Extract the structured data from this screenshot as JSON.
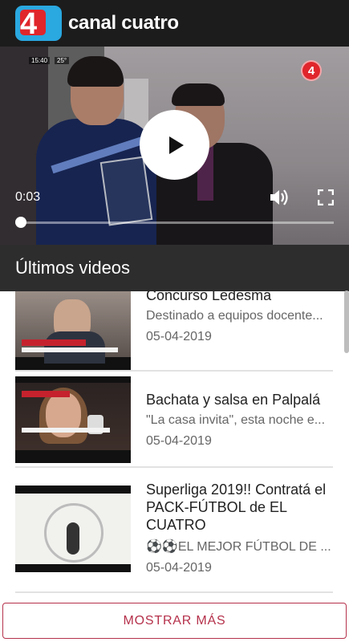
{
  "header": {
    "logo_text": "4",
    "brand": "canal cuatro"
  },
  "player": {
    "overlay_clock": "15:40",
    "overlay_temp": "25°",
    "watermark": "4",
    "current_time": "0:03",
    "progress_fraction": 0.0
  },
  "section": {
    "title": "Últimos videos"
  },
  "videos": [
    {
      "title": "Concurso Ledesma",
      "description": "Destinado a equipos docente...",
      "date": "05-04-2019"
    },
    {
      "title": "Bachata y salsa en Palpalá",
      "description": "\"La casa invita\", esta noche e...",
      "date": "05-04-2019"
    },
    {
      "title": "Superliga 2019!! Contratá el PACK-FÚTBOL de EL CUATRO",
      "description": "⚽⚽EL MEJOR FÚTBOL DE ...",
      "date": "05-04-2019"
    }
  ],
  "show_more_label": "MOSTRAR MÁS",
  "colors": {
    "header_bg": "#1c1c1c",
    "section_bg": "#2d2d2d",
    "accent": "#b5314b",
    "logo_blue": "#2aa8e0",
    "logo_red": "#e0252b"
  }
}
